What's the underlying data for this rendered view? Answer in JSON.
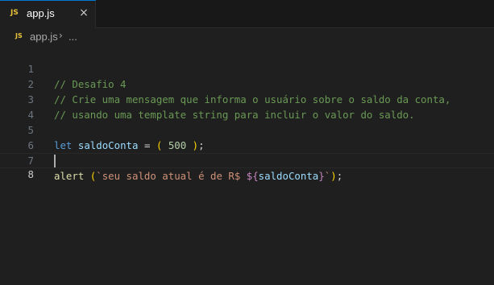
{
  "tab": {
    "icon_text": "JS",
    "filename": "app.js",
    "close_glyph": "×"
  },
  "breadcrumb": {
    "icon_text": "JS",
    "file": "app.js",
    "separator": "›",
    "more": "..."
  },
  "colors": {
    "comment": "#6a9955",
    "keyword": "#569cd6",
    "variable": "#9cdcfe",
    "number": "#b5cea8",
    "function": "#dcdcaa",
    "string": "#ce9178",
    "template_punct": "#c586c0",
    "bracket": "#ffd700",
    "tab_accent": "#0078d4"
  },
  "editor": {
    "current_line": "8",
    "lines": [
      {
        "number": "1",
        "text": "// Desafio 4"
      },
      {
        "number": "2",
        "text": "// Crie uma mensagem que informa o usuário sobre o saldo da conta,"
      },
      {
        "number": "3",
        "text": "// usando uma template string para incluir o valor do saldo."
      },
      {
        "number": "4",
        "text": ""
      },
      {
        "number": "5",
        "tokens": {
          "kw": "let",
          "var": "saldoConta",
          "eq": "=",
          "open": "(",
          "num": "500",
          "close": ")",
          "semi": ";"
        }
      },
      {
        "number": "6",
        "text": ""
      },
      {
        "number": "7",
        "tokens": {
          "fn": "alert",
          "open": "(",
          "str": "`seu saldo atual é de R$ ",
          "tmpl_open": "${",
          "var": "saldoConta",
          "tmpl_close": "}",
          "str_end": "`",
          "close": ")",
          "semi": ";"
        }
      },
      {
        "number": "8",
        "text": ""
      }
    ]
  }
}
